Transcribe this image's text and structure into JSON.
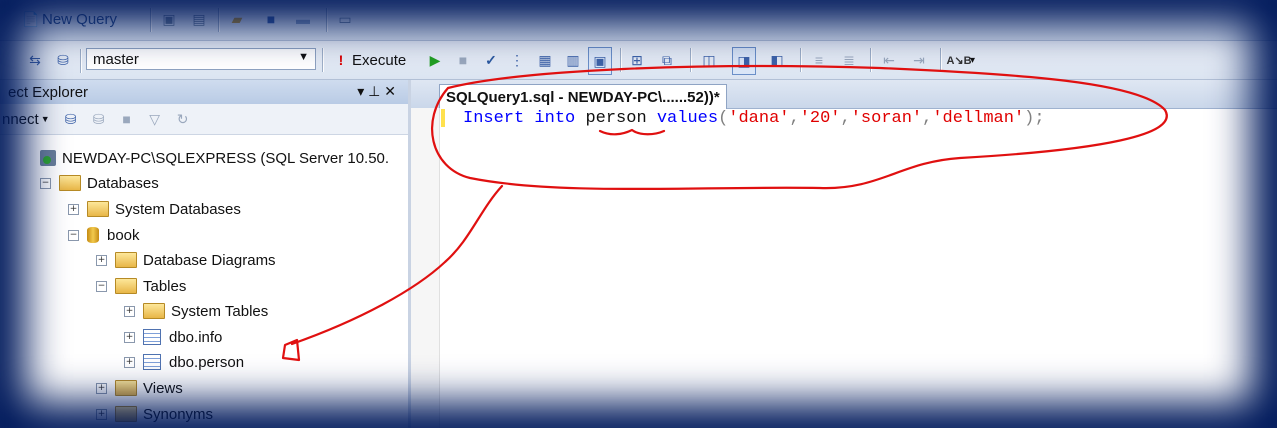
{
  "toolbar_top": {
    "new_query_label": "New Query"
  },
  "toolbar_query": {
    "database": "master",
    "execute_label": "Execute"
  },
  "object_explorer": {
    "title": "ect Explorer",
    "pin_glyph": "▾ ⊥ ✕",
    "connect_label": "nnect",
    "tree": {
      "server": "NEWDAY-PC\\SQLEXPRESS (SQL Server 10.50.",
      "databases": "Databases",
      "system_databases": "System Databases",
      "book": "book",
      "database_diagrams": "Database Diagrams",
      "tables": "Tables",
      "system_tables": "System Tables",
      "dbo_info": "dbo.info",
      "dbo_person": "dbo.person",
      "views": "Views",
      "synonyms": "Synonyms"
    }
  },
  "editor": {
    "tab_label": "SQLQuery1.sql - NEWDAY-PC\\......52))*",
    "code": {
      "kw_insert": "Insert",
      "kw_into": "into",
      "table": "person",
      "kw_values": "values",
      "open_paren": "(",
      "v1": "'dana'",
      "comma1": ",",
      "v2": "'20'",
      "comma2": ",",
      "v3": "'soran'",
      "comma3": ",",
      "v4": "'dellman'",
      "close": ");"
    }
  },
  "annotation": {
    "color": "#e01010"
  },
  "colors": {
    "frame": "#001a5c",
    "keyword": "#0000ff",
    "string": "#e00000"
  }
}
